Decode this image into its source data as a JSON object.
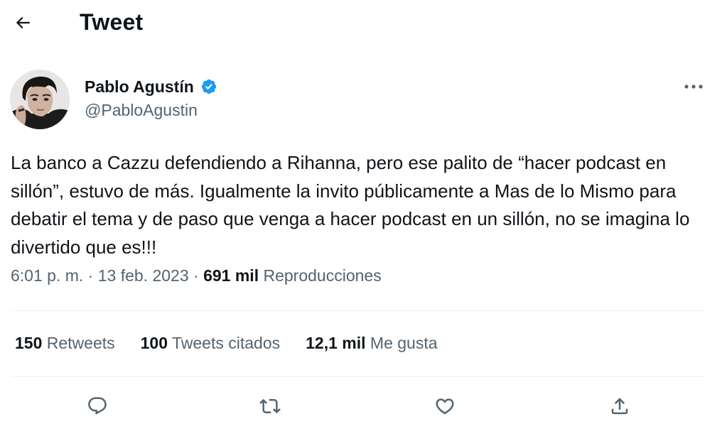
{
  "header": {
    "title": "Tweet"
  },
  "author": {
    "name": "Pablo Agustín",
    "handle": "@PabloAgustin"
  },
  "tweet": {
    "text": "La banco a Cazzu defendiendo a Rihanna, pero ese palito de “hacer podcast en sillón”, estuvo de más. Igualmente la invito públicamente a Mas de lo Mismo para debatir el tema y de paso que venga a hacer podcast en un sillón, no se imagina lo divertido que es!!!",
    "time": "6:01 p. m.",
    "separator": "·",
    "date": "13 feb. 2023",
    "views_count": "691 mil",
    "views_label": "Reproducciones"
  },
  "stats": {
    "retweets_count": "150",
    "retweets_label": "Retweets",
    "quotes_count": "100",
    "quotes_label": "Tweets citados",
    "likes_count": "12,1 mil",
    "likes_label": "Me gusta"
  },
  "colors": {
    "verified": "#1d9bf0",
    "secondary_text": "#536471",
    "primary_text": "#0f1419",
    "divider": "#eff3f4"
  },
  "icons": {
    "back": "arrow-left-icon",
    "verified": "verified-badge-icon",
    "more": "more-horizontal-icon",
    "reply": "reply-icon",
    "retweet": "retweet-icon",
    "like": "heart-icon",
    "share": "share-icon"
  }
}
